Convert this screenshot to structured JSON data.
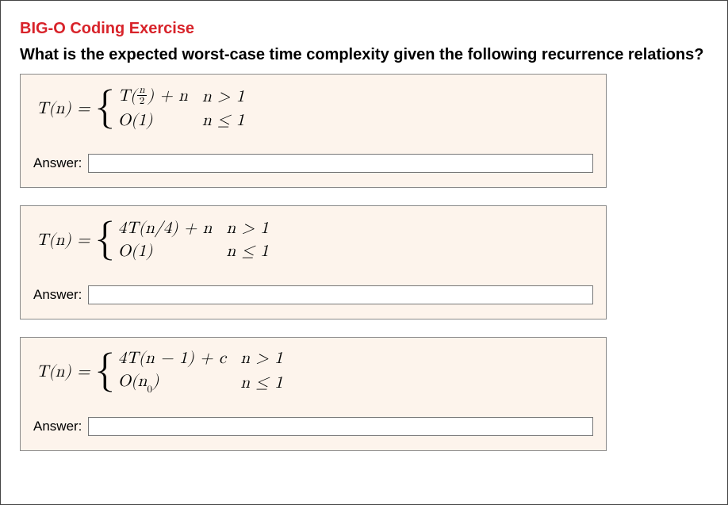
{
  "title": "BIG-O Coding Exercise",
  "question": "What is the expected worst-case time complexity given the following recurrence relations?",
  "lhs": "T(n) = ",
  "answer_label": "Answer:",
  "problems": [
    {
      "case1_expr_prefix": "T(",
      "case1_frac_num": "n",
      "case1_frac_den": "2",
      "case1_expr_suffix": ") + n",
      "case1_cond": "n > 1",
      "case2_expr": "O(1)",
      "case2_cond": "n ≤ 1",
      "answer": ""
    },
    {
      "case1_expr": "4T(n/4) + n",
      "case1_cond": "n > 1",
      "case2_expr": "O(1)",
      "case2_cond": "n ≤ 1",
      "answer": ""
    },
    {
      "case1_expr": "4T(n − 1) + c",
      "case1_cond": "n > 1",
      "case2_expr_prefix": "O(n",
      "case2_expr_sub": "0",
      "case2_expr_suffix": ")",
      "case2_cond": "n ≤ 1",
      "answer": ""
    }
  ]
}
